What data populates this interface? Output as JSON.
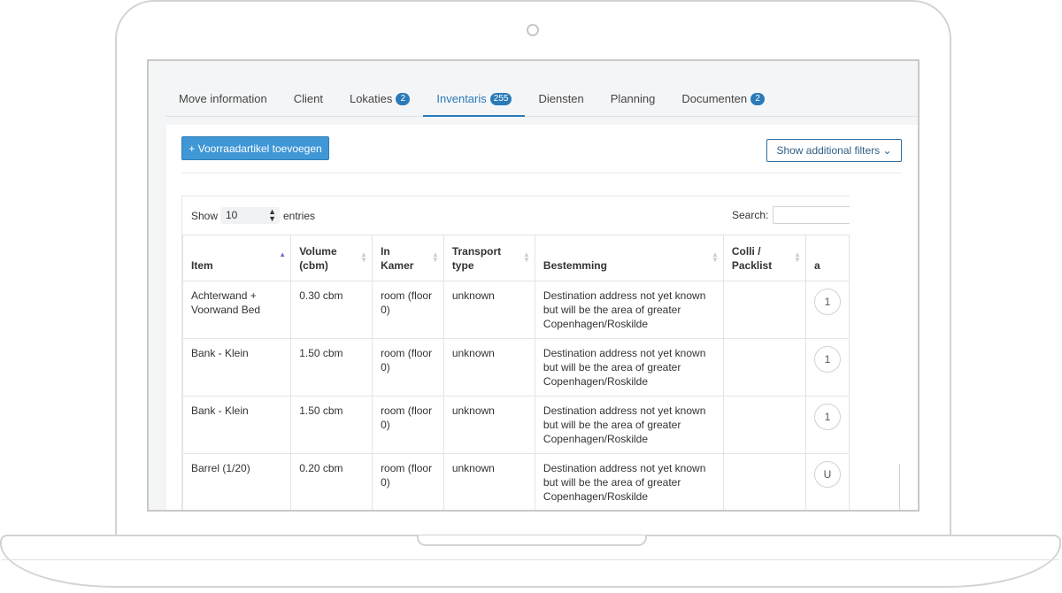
{
  "tabs": [
    {
      "label": "Move information",
      "badge": ""
    },
    {
      "label": "Client",
      "badge": ""
    },
    {
      "label": "Lokaties",
      "badge": "2"
    },
    {
      "label": "Inventaris",
      "badge": "255",
      "active": true
    },
    {
      "label": "Diensten",
      "badge": ""
    },
    {
      "label": "Planning",
      "badge": ""
    },
    {
      "label": "Documenten",
      "badge": "2"
    }
  ],
  "toolbar": {
    "add_label": "+ Voorraadartikel toevoegen",
    "filters_label": "Show additional filters ⌄"
  },
  "datatable": {
    "show_label": "Show",
    "length_value": "10",
    "entries_label": "entries",
    "search_label": "Search:",
    "search_value": ""
  },
  "columns": [
    {
      "line1": "",
      "line2": "Item"
    },
    {
      "line1": "Volume",
      "line2": "(cbm)"
    },
    {
      "line1": "In",
      "line2": "Kamer"
    },
    {
      "line1": "Transport",
      "line2": "type"
    },
    {
      "line1": "",
      "line2": "Bestemming"
    },
    {
      "line1": "Colli /",
      "line2": "Packlist"
    },
    {
      "line1": "",
      "line2": "a"
    }
  ],
  "rows": [
    {
      "item": "Achterwand + Voorwand Bed",
      "volume": "0.30 cbm",
      "room": "room (floor 0)",
      "transport": "unknown",
      "destination": "Destination address not yet known but will be the area of greater Copenhagen/Roskilde",
      "colli": "",
      "action": "1"
    },
    {
      "item": "Bank - Klein",
      "volume": "1.50 cbm",
      "room": "room (floor 0)",
      "transport": "unknown",
      "destination": "Destination address not yet known but will be the area of greater Copenhagen/Roskilde",
      "colli": "",
      "action": "1"
    },
    {
      "item": "Bank - Klein",
      "volume": "1.50 cbm",
      "room": "room (floor 0)",
      "transport": "unknown",
      "destination": "Destination address not yet known but will be the area of greater Copenhagen/Roskilde",
      "colli": "",
      "action": "1"
    },
    {
      "item": "Barrel (1/20)",
      "volume": "0.20 cbm",
      "room": "room (floor 0)",
      "transport": "unknown",
      "destination": "Destination address not yet known but will be the area of greater Copenhagen/Roskilde",
      "colli": "",
      "action": "U"
    }
  ],
  "colors": {
    "accent": "#2a7ab8",
    "button": "#3f97d6"
  }
}
